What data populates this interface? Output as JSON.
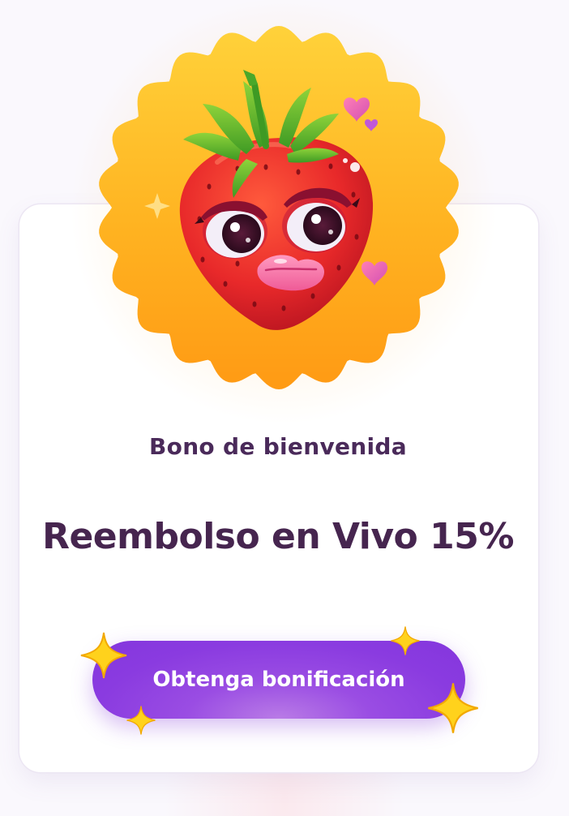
{
  "bonus_card": {
    "badge_image": "strawberry-mascot-icon",
    "subtitle": "Bono de bienvenida",
    "title": "Reembolso en Vivo 15%",
    "cta_label": "Obtenga bonificación"
  },
  "colors": {
    "title_text": "#46254f",
    "subtitle_text": "#4a2a5a",
    "button_purple": "#8a3be0",
    "badge_orange": "#ffb020",
    "card_background": "#ffffff"
  }
}
